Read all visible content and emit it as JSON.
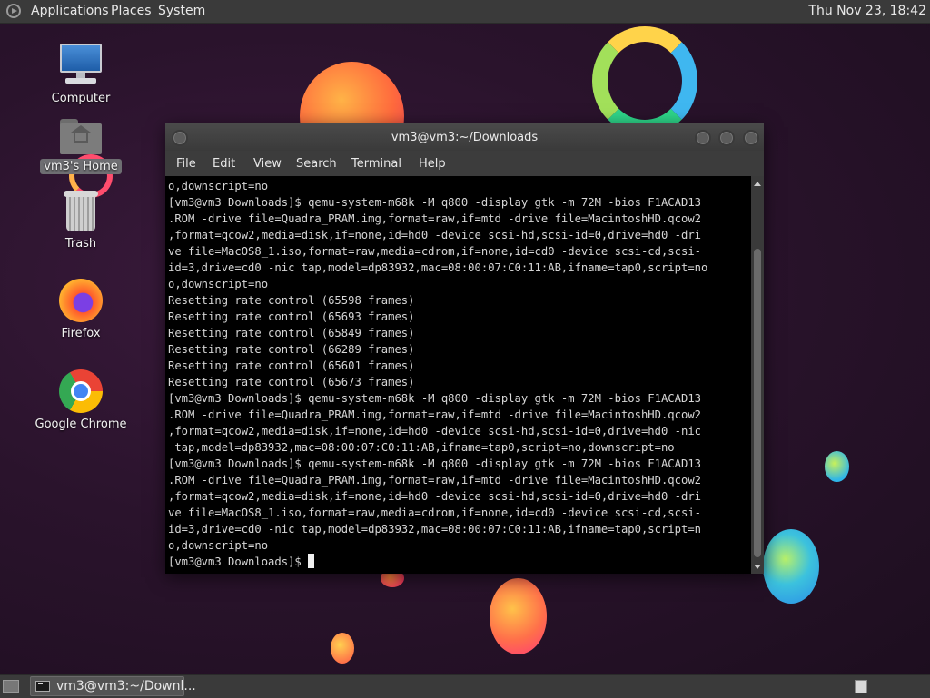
{
  "top_panel": {
    "menus": [
      "Applications",
      "Places",
      "System"
    ],
    "clock": "Thu Nov 23, 18:42"
  },
  "desktop": {
    "icons": [
      {
        "label": "Computer",
        "icon": "computer-icon"
      },
      {
        "label": "vm3's Home",
        "icon": "home-folder-icon",
        "selected": true
      },
      {
        "label": "Trash",
        "icon": "trash-icon"
      },
      {
        "label": "Firefox",
        "icon": "firefox-icon"
      },
      {
        "label": "Google Chrome",
        "icon": "chrome-icon"
      }
    ]
  },
  "window": {
    "title": "vm3@vm3:~/Downloads",
    "menus": [
      "File",
      "Edit",
      "View",
      "Search",
      "Terminal",
      "Help"
    ],
    "terminal_lines": [
      "o,downscript=no",
      "[vm3@vm3 Downloads]$ qemu-system-m68k -M q800 -display gtk -m 72M -bios F1ACAD13",
      ".ROM -drive file=Quadra_PRAM.img,format=raw,if=mtd -drive file=MacintoshHD.qcow2",
      ",format=qcow2,media=disk,if=none,id=hd0 -device scsi-hd,scsi-id=0,drive=hd0 -dri",
      "ve file=MacOS8_1.iso,format=raw,media=cdrom,if=none,id=cd0 -device scsi-cd,scsi-",
      "id=3,drive=cd0 -nic tap,model=dp83932,mac=08:00:07:C0:11:AB,ifname=tap0,script=no",
      "o,downscript=no",
      "Resetting rate control (65598 frames)",
      "Resetting rate control (65693 frames)",
      "Resetting rate control (65849 frames)",
      "Resetting rate control (66289 frames)",
      "Resetting rate control (65601 frames)",
      "Resetting rate control (65673 frames)",
      "[vm3@vm3 Downloads]$ qemu-system-m68k -M q800 -display gtk -m 72M -bios F1ACAD13",
      ".ROM -drive file=Quadra_PRAM.img,format=raw,if=mtd -drive file=MacintoshHD.qcow2",
      ",format=qcow2,media=disk,if=none,id=hd0 -device scsi-hd,scsi-id=0,drive=hd0 -nic",
      " tap,model=dp83932,mac=08:00:07:C0:11:AB,ifname=tap0,script=no,downscript=no",
      "[vm3@vm3 Downloads]$ qemu-system-m68k -M q800 -display gtk -m 72M -bios F1ACAD13",
      ".ROM -drive file=Quadra_PRAM.img,format=raw,if=mtd -drive file=MacintoshHD.qcow2",
      ",format=qcow2,media=disk,if=none,id=hd0 -device scsi-hd,scsi-id=0,drive=hd0 -dri",
      "ve file=MacOS8_1.iso,format=raw,media=cdrom,if=none,id=cd0 -device scsi-cd,scsi-",
      "id=3,drive=cd0 -nic tap,model=dp83932,mac=08:00:07:C0:11:AB,ifname=tap0,script=n",
      "o,downscript=no"
    ],
    "prompt": "[vm3@vm3 Downloads]$ "
  },
  "bottom_panel": {
    "task_label": "vm3@vm3:~/Downl..."
  },
  "colors": {
    "panel": "#3a3a3a",
    "terminal_bg": "#000000",
    "terminal_fg": "#d6d6d6"
  }
}
